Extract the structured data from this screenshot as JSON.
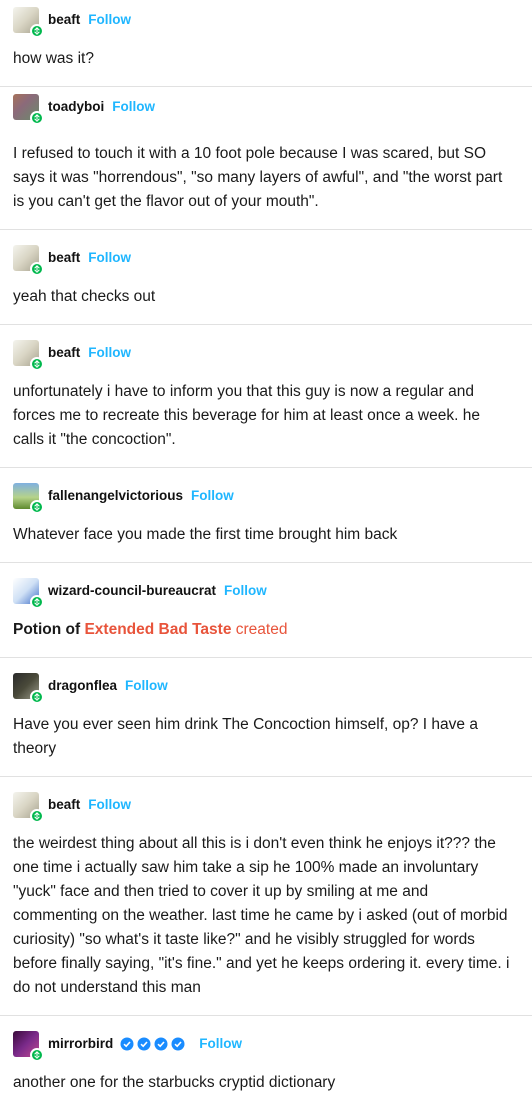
{
  "colors": {
    "follow": "#1fb6ff",
    "badge": "#00b84d",
    "accent_red": "#e8543b",
    "divider": "#e1e1e1"
  },
  "follow_label": "Follow",
  "posts": [
    {
      "username": "beaft",
      "text": "how was it?"
    },
    {
      "username": "toadyboi",
      "text": "I refused to touch it with a 10 foot pole because I was scared, but SO says it was \"horrendous\", \"so many layers of awful\", and \"the worst part is you can't get the flavor out of your mouth\"."
    },
    {
      "username": "beaft",
      "text": "yeah that checks out"
    },
    {
      "username": "beaft",
      "text": "unfortunately i have to inform you that this guy is now a regular and forces me to recreate this beverage for him at least once a week. he calls it \"the concoction\"."
    },
    {
      "username": "fallenangelvictorious",
      "text": "Whatever face you made the first time brought him back"
    },
    {
      "username": "wizard-council-bureaucrat",
      "text_parts": {
        "prefix": "Potion of ",
        "highlight": "Extended Bad Taste",
        "suffix": " created"
      }
    },
    {
      "username": "dragonflea",
      "text": "Have you ever seen him drink The Concoction himself, op? I have a theory"
    },
    {
      "username": "beaft",
      "text": "the weirdest thing about all this is i don't even think he enjoys it??? the one time i actually saw him take a sip he 100% made an involuntary \"yuck\" face and then tried to cover it up by smiling at me and commenting on the weather. last time he came by i asked (out of morbid curiosity) \"so what's it taste like?\" and he visibly struggled for words before finally saying, \"it's fine.\" and yet he keeps ordering it. every time. i do not understand this man"
    },
    {
      "username": "mirrorbird",
      "verified_badges": 4,
      "text": "another one for the starbucks cryptid dictionary"
    }
  ]
}
